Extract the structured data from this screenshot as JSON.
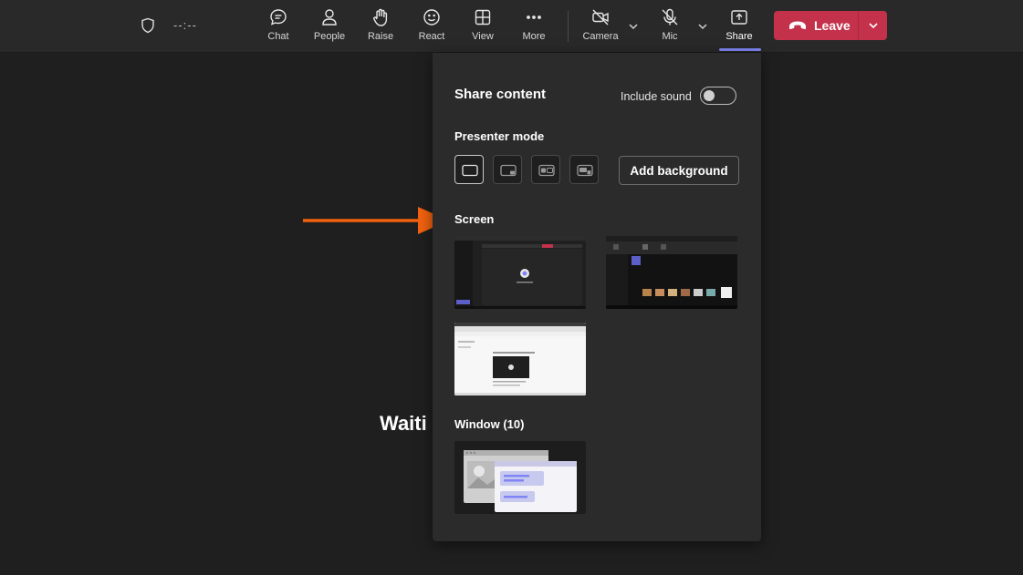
{
  "toolbar": {
    "timer": "--:--",
    "items": [
      {
        "label": "Chat"
      },
      {
        "label": "People"
      },
      {
        "label": "Raise"
      },
      {
        "label": "React"
      },
      {
        "label": "View"
      },
      {
        "label": "More"
      },
      {
        "label": "Camera"
      },
      {
        "label": "Mic"
      },
      {
        "label": "Share"
      }
    ],
    "leave_label": "Leave",
    "leave_color": "#c4314b",
    "accent_color": "#7f85f5",
    "icons": [
      "shield-icon",
      "chat-icon",
      "people-icon",
      "hand-icon",
      "smiley-icon",
      "view-grid-icon",
      "more-icon",
      "camera-off-icon",
      "mic-off-icon",
      "share-tray-icon",
      "phone-hangup-icon",
      "chevron-down-icon"
    ]
  },
  "stage": {
    "waiting_text": "Waiti"
  },
  "share_panel": {
    "title": "Share content",
    "include_sound_label": "Include sound",
    "include_sound_on": false,
    "presenter_mode_label": "Presenter mode",
    "add_background_label": "Add background",
    "screen_label": "Screen",
    "window_label": "Window (10)",
    "annotation_arrow_color": "#f2620f"
  }
}
